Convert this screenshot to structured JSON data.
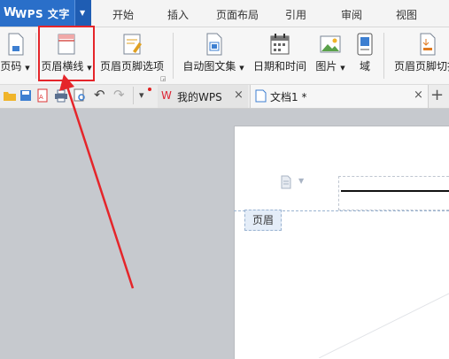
{
  "menubar": {
    "app_title": "WPS 文字",
    "tabs": [
      "开始",
      "插入",
      "页面布局",
      "引用",
      "审阅",
      "视图"
    ]
  },
  "toolbar": {
    "page_number": "页码",
    "header_line": "页眉横线",
    "header_footer_options": "页眉页脚选项",
    "auto_text": "自动图文集",
    "date_time": "日期和时间",
    "picture": "图片",
    "field": "域",
    "header_footer_switch": "页眉页脚切换"
  },
  "doc_tabs": {
    "my_wps": "我的WPS",
    "doc1": "文档1 *",
    "close_glyph": "×",
    "new_tab_glyph": "+"
  },
  "page": {
    "header_label": "页眉"
  },
  "colors": {
    "accent": "#2a6fc9",
    "highlight": "#e5252a",
    "workspace": "#c6c9ce"
  }
}
